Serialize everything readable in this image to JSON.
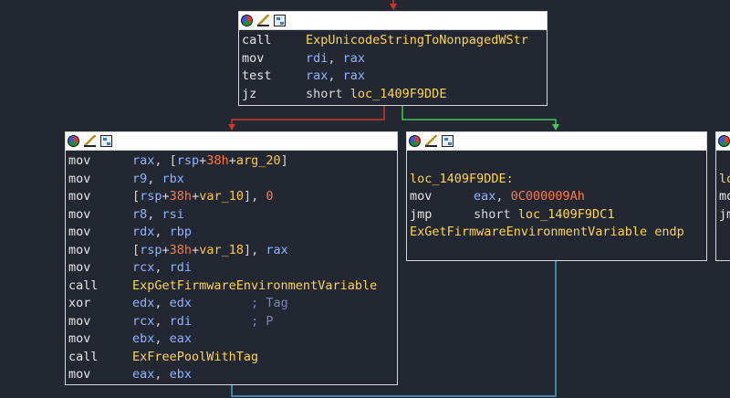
{
  "colors": {
    "background": "#232732",
    "edge_false": "#c9392b",
    "edge_true": "#3ec95a",
    "edge_normal": "#4aa9c8",
    "register": "#8fb4ff",
    "symbol": "#ffd54a",
    "number": "#ff7a45",
    "comment": "#7787b4"
  },
  "header_icons": [
    "color-wheel-icon",
    "rename-icon",
    "graph-icon"
  ],
  "blocks": {
    "top": {
      "lines": [
        {
          "mnemonic": "call",
          "operands": [
            {
              "t": "sym",
              "v": "ExpUnicodeStringToNonpagedWStr"
            }
          ]
        },
        {
          "mnemonic": "mov",
          "operands": [
            {
              "t": "reg",
              "v": "rdi"
            },
            {
              "t": "pun",
              "v": ", "
            },
            {
              "t": "reg",
              "v": "rax"
            }
          ]
        },
        {
          "mnemonic": "test",
          "operands": [
            {
              "t": "reg",
              "v": "rax"
            },
            {
              "t": "pun",
              "v": ", "
            },
            {
              "t": "reg",
              "v": "rax"
            }
          ]
        },
        {
          "mnemonic": "jz",
          "operands": [
            {
              "t": "pun",
              "v": "short "
            },
            {
              "t": "sym",
              "v": "loc_1409F9DDE"
            }
          ]
        }
      ]
    },
    "left": {
      "lines": [
        {
          "mnemonic": "mov",
          "operands": [
            {
              "t": "reg",
              "v": "rax"
            },
            {
              "t": "pun",
              "v": ", ["
            },
            {
              "t": "reg",
              "v": "rsp"
            },
            {
              "t": "pun",
              "v": "+"
            },
            {
              "t": "num",
              "v": "38h"
            },
            {
              "t": "pun",
              "v": "+"
            },
            {
              "t": "var",
              "v": "arg_20"
            },
            {
              "t": "pun",
              "v": "]"
            }
          ]
        },
        {
          "mnemonic": "mov",
          "operands": [
            {
              "t": "reg",
              "v": "r9"
            },
            {
              "t": "pun",
              "v": ", "
            },
            {
              "t": "reg",
              "v": "rbx"
            }
          ]
        },
        {
          "mnemonic": "mov",
          "operands": [
            {
              "t": "pun",
              "v": "["
            },
            {
              "t": "reg",
              "v": "rsp"
            },
            {
              "t": "pun",
              "v": "+"
            },
            {
              "t": "num",
              "v": "38h"
            },
            {
              "t": "pun",
              "v": "+"
            },
            {
              "t": "var",
              "v": "var_10"
            },
            {
              "t": "pun",
              "v": "], "
            },
            {
              "t": "num",
              "v": "0"
            }
          ]
        },
        {
          "mnemonic": "mov",
          "operands": [
            {
              "t": "reg",
              "v": "r8"
            },
            {
              "t": "pun",
              "v": ", "
            },
            {
              "t": "reg",
              "v": "rsi"
            }
          ]
        },
        {
          "mnemonic": "mov",
          "operands": [
            {
              "t": "reg",
              "v": "rdx"
            },
            {
              "t": "pun",
              "v": ", "
            },
            {
              "t": "reg",
              "v": "rbp"
            }
          ]
        },
        {
          "mnemonic": "mov",
          "operands": [
            {
              "t": "pun",
              "v": "["
            },
            {
              "t": "reg",
              "v": "rsp"
            },
            {
              "t": "pun",
              "v": "+"
            },
            {
              "t": "num",
              "v": "38h"
            },
            {
              "t": "pun",
              "v": "+"
            },
            {
              "t": "var",
              "v": "var_18"
            },
            {
              "t": "pun",
              "v": "], "
            },
            {
              "t": "reg",
              "v": "rax"
            }
          ]
        },
        {
          "mnemonic": "mov",
          "operands": [
            {
              "t": "reg",
              "v": "rcx"
            },
            {
              "t": "pun",
              "v": ", "
            },
            {
              "t": "reg",
              "v": "rdi"
            }
          ]
        },
        {
          "mnemonic": "call",
          "operands": [
            {
              "t": "sym",
              "v": "ExpGetFirmwareEnvironmentVariable"
            }
          ]
        },
        {
          "mnemonic": "xor",
          "operands": [
            {
              "t": "reg",
              "v": "edx"
            },
            {
              "t": "pun",
              "v": ", "
            },
            {
              "t": "reg",
              "v": "edx"
            },
            {
              "t": "pun",
              "v": "        "
            },
            {
              "t": "cmt",
              "v": "; Tag"
            }
          ]
        },
        {
          "mnemonic": "mov",
          "operands": [
            {
              "t": "reg",
              "v": "rcx"
            },
            {
              "t": "pun",
              "v": ", "
            },
            {
              "t": "reg",
              "v": "rdi"
            },
            {
              "t": "pun",
              "v": "        "
            },
            {
              "t": "cmt",
              "v": "; P"
            }
          ]
        },
        {
          "mnemonic": "mov",
          "operands": [
            {
              "t": "reg",
              "v": "ebx"
            },
            {
              "t": "pun",
              "v": ", "
            },
            {
              "t": "reg",
              "v": "eax"
            }
          ]
        },
        {
          "mnemonic": "call",
          "operands": [
            {
              "t": "sym",
              "v": "ExFreePoolWithTag"
            }
          ]
        },
        {
          "mnemonic": "mov",
          "operands": [
            {
              "t": "reg",
              "v": "eax"
            },
            {
              "t": "pun",
              "v": ", "
            },
            {
              "t": "reg",
              "v": "ebx"
            }
          ]
        }
      ]
    },
    "middle": {
      "lines": [
        {
          "mnemonic": "",
          "operands": []
        },
        {
          "label": "loc_1409F9DDE:"
        },
        {
          "mnemonic": "mov",
          "operands": [
            {
              "t": "reg",
              "v": "eax"
            },
            {
              "t": "pun",
              "v": ", "
            },
            {
              "t": "num",
              "v": "0C000009Ah"
            }
          ]
        },
        {
          "mnemonic": "jmp",
          "operands": [
            {
              "t": "pun",
              "v": "short "
            },
            {
              "t": "sym",
              "v": "loc_1409F9DC1"
            }
          ]
        },
        {
          "label": "ExGetFirmwareEnvironmentVariable endp"
        }
      ]
    },
    "right": {
      "lines": [
        {
          "mnemonic": "",
          "operands": []
        },
        {
          "label": "lo"
        },
        {
          "mnemonic": "mo",
          "operands": []
        },
        {
          "mnemonic": "jm",
          "operands": []
        }
      ]
    }
  }
}
